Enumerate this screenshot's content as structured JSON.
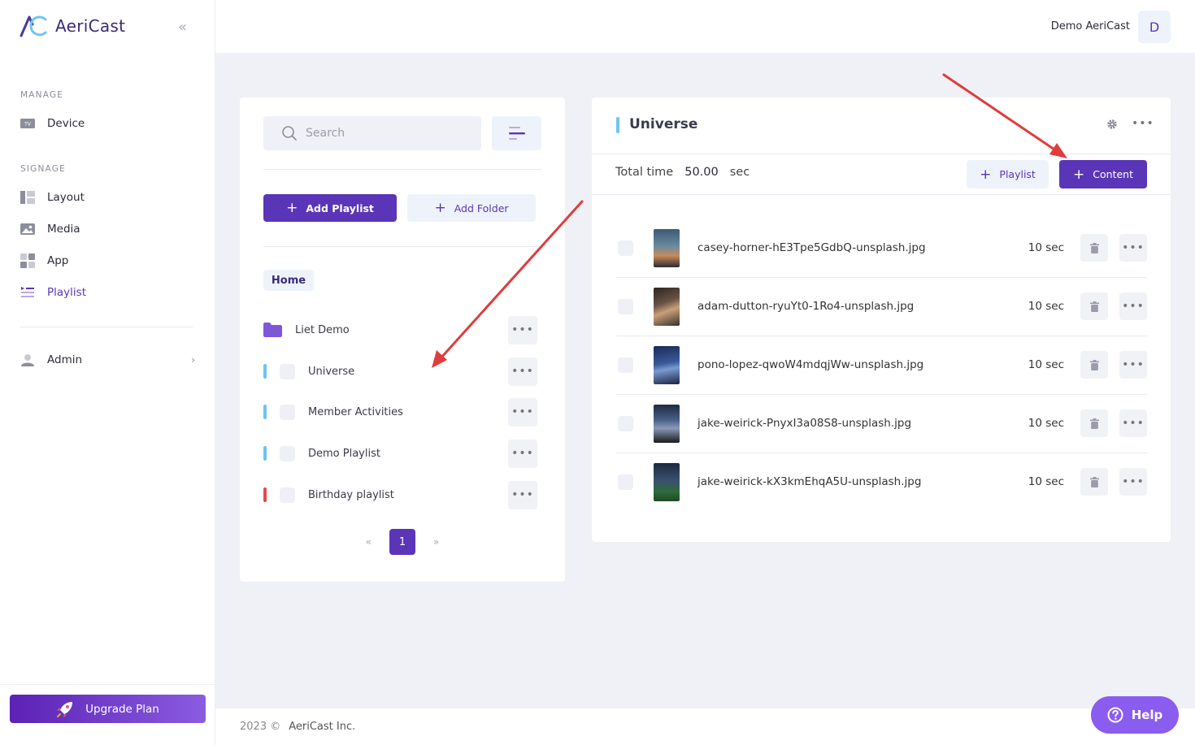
{
  "brand": {
    "name": "AeriCast"
  },
  "sidebar": {
    "sections": [
      {
        "label": "MANAGE"
      },
      {
        "label": "SIGNAGE"
      }
    ],
    "items": [
      {
        "label": "Device",
        "icon": "tv-icon"
      },
      {
        "label": "Layout",
        "icon": "layout-icon"
      },
      {
        "label": "Media",
        "icon": "image-icon"
      },
      {
        "label": "App",
        "icon": "grid-icon"
      },
      {
        "label": "Playlist",
        "icon": "playlist-icon",
        "active": true
      },
      {
        "label": "Admin",
        "icon": "user-icon"
      }
    ],
    "upgrade_label": "Upgrade Plan"
  },
  "topbar": {
    "user_name": "Demo AeriCast",
    "avatar_initial": "D"
  },
  "library": {
    "search_placeholder": "Search",
    "add_playlist_label": "Add Playlist",
    "add_folder_label": "Add Folder",
    "breadcrumb": "Home",
    "folders": [
      {
        "label": "Liet Demo"
      }
    ],
    "playlists": [
      {
        "label": "Universe",
        "color": "#6ec4f0"
      },
      {
        "label": "Member Activities",
        "color": "#6ec4f0"
      },
      {
        "label": "Demo Playlist",
        "color": "#6ec4f0"
      },
      {
        "label": "Birthday playlist",
        "color": "#e5484d"
      }
    ],
    "pager": {
      "prev": "«",
      "current": "1",
      "next": "»"
    }
  },
  "detail": {
    "title": "Universe",
    "total_label": "Total time",
    "total_value": "50.00",
    "total_unit": "sec",
    "add_playlist_label": "Playlist",
    "add_content_label": "Content",
    "items": [
      {
        "filename": "casey-horner-hE3Tpe5GdbQ-unsplash.jpg",
        "duration": "10 sec"
      },
      {
        "filename": "adam-dutton-ryuYt0-1Ro4-unsplash.jpg",
        "duration": "10 sec"
      },
      {
        "filename": "pono-lopez-qwoW4mdqjWw-unsplash.jpg",
        "duration": "10 sec"
      },
      {
        "filename": "jake-weirick-PnyxI3a08S8-unsplash.jpg",
        "duration": "10 sec"
      },
      {
        "filename": "jake-weirick-kX3kmEhqA5U-unsplash.jpg",
        "duration": "10 sec"
      }
    ]
  },
  "footer": {
    "year": "2023 ©",
    "company": "AeriCast Inc."
  },
  "help_label": "Help",
  "colors": {
    "accent": "#5a35b8",
    "annotation_arrow": "#e03c3c"
  }
}
